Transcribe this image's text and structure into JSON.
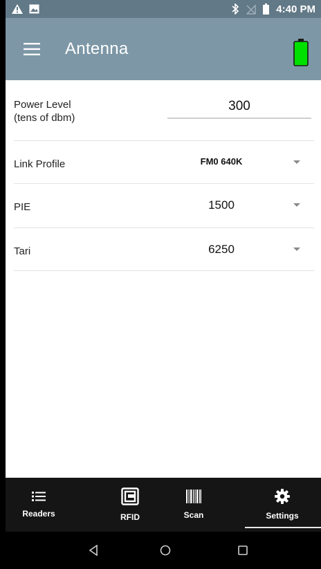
{
  "status_bar": {
    "time": "4:40 PM",
    "icons": [
      "warning-icon",
      "gallery-icon",
      "bluetooth-icon",
      "no-sim-icon",
      "battery-icon"
    ]
  },
  "app_bar": {
    "title": "Antenna",
    "menu_icon": "hamburger-menu-icon",
    "battery_icon": "battery-full-icon",
    "battery_color": "#00e000"
  },
  "settings": {
    "power_level": {
      "label_line1": "Power Level",
      "label_line2": "(tens of dbm)",
      "value": "300"
    },
    "link_profile": {
      "label": "Link Profile",
      "value": "FM0 640K"
    },
    "pie": {
      "label": "PIE",
      "value": "1500"
    },
    "tari": {
      "label": "Tari",
      "value": "6250"
    }
  },
  "bottom_nav": {
    "items": [
      {
        "label": "Readers",
        "icon": "list-icon"
      },
      {
        "label": "RFID",
        "icon": "rfid-icon"
      },
      {
        "label": "Scan",
        "icon": "barcode-icon"
      },
      {
        "label": "Settings",
        "icon": "gear-icon",
        "selected": true
      }
    ]
  },
  "system_nav": {
    "buttons": [
      "back-icon",
      "home-icon",
      "recents-icon"
    ]
  },
  "colors": {
    "status_bar": "#627987",
    "app_bar": "#7d97a6",
    "bottom_nav": "#151515"
  }
}
